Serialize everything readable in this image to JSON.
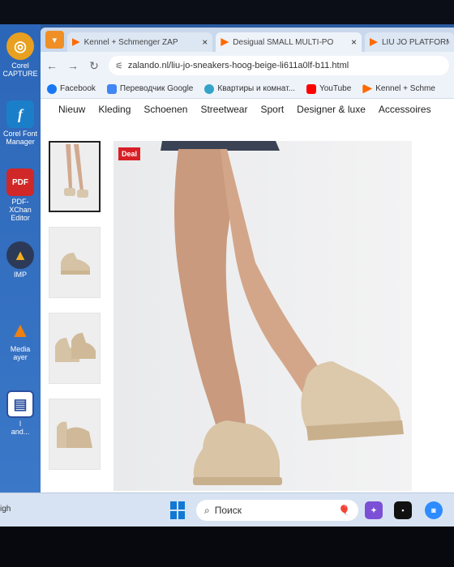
{
  "desktop": {
    "icons": [
      {
        "label": "Corel\nCAPTURE",
        "icon": "corel-capture-icon",
        "color": "#e8a020"
      },
      {
        "label": "Corel Font\nManager",
        "icon": "font-manager-icon",
        "color": "#1a7fc8"
      },
      {
        "label": "PDF-XChan\nEditor",
        "icon": "pdf-icon",
        "color": "#d02828"
      },
      {
        "label": "IMP",
        "icon": "gimp-icon",
        "color": "#2c3a58"
      },
      {
        "label": "Media\nayer",
        "icon": "vlc-icon",
        "color": "#f08010"
      },
      {
        "label": "l\nand...",
        "icon": "file-icon",
        "color": "#2a4fa0"
      }
    ]
  },
  "tabs": [
    {
      "title": "Kennel + Schmenger ZAP"
    },
    {
      "title": "Desigual SMALL MULTI-PO"
    },
    {
      "title": "LIU JO PLATFORM - Sn"
    }
  ],
  "address": {
    "url": "zalando.nl/liu-jo-sneakers-hoog-beige-li611a0lf-b11.html"
  },
  "bookmarks": [
    {
      "label": "Facebook",
      "color": "#1877f2"
    },
    {
      "label": "Переводчик Google",
      "color": "#4285f4"
    },
    {
      "label": "Квартиры и комнат...",
      "color": "#35a3c8"
    },
    {
      "label": "YouTube",
      "color": "#ff0000"
    },
    {
      "label": "Kennel + Schme",
      "color": "#ff6a00"
    }
  ],
  "categories": [
    "Nieuw",
    "Kleding",
    "Schoenen",
    "Streetwear",
    "Sport",
    "Designer & luxe",
    "Accessoires"
  ],
  "product": {
    "badge": "Deal"
  },
  "taskbar": {
    "search_placeholder": "Поиск",
    "time_fragment": "igh",
    "apps": [
      {
        "name": "copilot",
        "color": "#7b4fd6"
      },
      {
        "name": "terminal",
        "color": "#111111"
      },
      {
        "name": "zoom",
        "color": "#2d8cff"
      }
    ]
  }
}
